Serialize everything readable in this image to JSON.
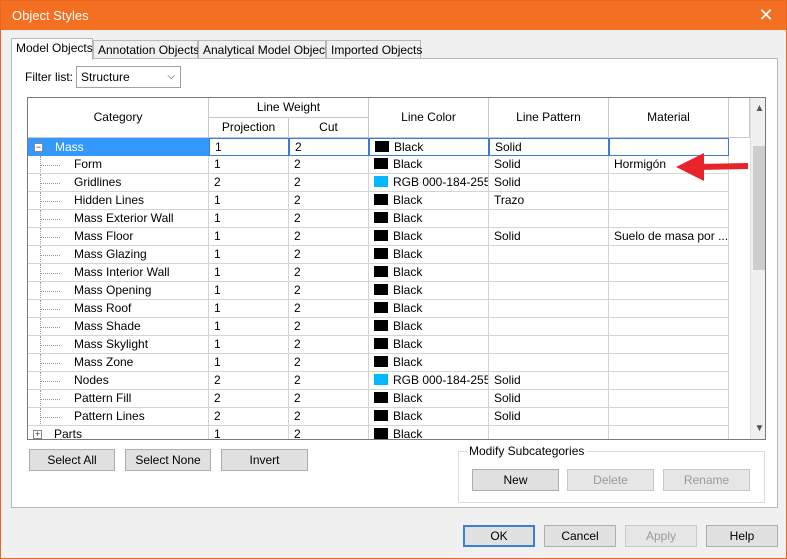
{
  "window": {
    "title": "Object Styles",
    "close_symbol": "✕"
  },
  "tabs": [
    {
      "label": "Model Objects"
    },
    {
      "label": "Annotation Objects"
    },
    {
      "label": "Analytical Model Objects"
    },
    {
      "label": "Imported Objects"
    }
  ],
  "filter": {
    "label": "Filter list:",
    "value": "Structure"
  },
  "grid": {
    "headers": {
      "category": "Category",
      "line_weight": "Line Weight",
      "projection": "Projection",
      "cut": "Cut",
      "line_color": "Line Color",
      "line_pattern": "Line Pattern",
      "material": "Material"
    },
    "rows": [
      {
        "category": "Mass",
        "projection": "1",
        "cut": "2",
        "color_hex": "#000000",
        "color": "Black",
        "pattern": "Solid",
        "material": ""
      },
      {
        "category": "Form",
        "projection": "1",
        "cut": "2",
        "color_hex": "#000000",
        "color": "Black",
        "pattern": "Solid",
        "material": "Hormigón"
      },
      {
        "category": "Gridlines",
        "projection": "2",
        "cut": "2",
        "color_hex": "#00b8ff",
        "color": "RGB 000-184-255",
        "pattern": "Solid",
        "material": ""
      },
      {
        "category": "Hidden Lines",
        "projection": "1",
        "cut": "2",
        "color_hex": "#000000",
        "color": "Black",
        "pattern": "Trazo",
        "material": ""
      },
      {
        "category": "Mass Exterior Wall",
        "projection": "1",
        "cut": "2",
        "color_hex": "#000000",
        "color": "Black",
        "pattern": "",
        "material": ""
      },
      {
        "category": "Mass Floor",
        "projection": "1",
        "cut": "2",
        "color_hex": "#000000",
        "color": "Black",
        "pattern": "Solid",
        "material": "Suelo de masa por ..."
      },
      {
        "category": "Mass Glazing",
        "projection": "1",
        "cut": "2",
        "color_hex": "#000000",
        "color": "Black",
        "pattern": "",
        "material": ""
      },
      {
        "category": "Mass Interior Wall",
        "projection": "1",
        "cut": "2",
        "color_hex": "#000000",
        "color": "Black",
        "pattern": "",
        "material": ""
      },
      {
        "category": "Mass Opening",
        "projection": "1",
        "cut": "2",
        "color_hex": "#000000",
        "color": "Black",
        "pattern": "",
        "material": ""
      },
      {
        "category": "Mass Roof",
        "projection": "1",
        "cut": "2",
        "color_hex": "#000000",
        "color": "Black",
        "pattern": "",
        "material": ""
      },
      {
        "category": "Mass Shade",
        "projection": "1",
        "cut": "2",
        "color_hex": "#000000",
        "color": "Black",
        "pattern": "",
        "material": ""
      },
      {
        "category": "Mass Skylight",
        "projection": "1",
        "cut": "2",
        "color_hex": "#000000",
        "color": "Black",
        "pattern": "",
        "material": ""
      },
      {
        "category": "Mass Zone",
        "projection": "1",
        "cut": "2",
        "color_hex": "#000000",
        "color": "Black",
        "pattern": "",
        "material": ""
      },
      {
        "category": "Nodes",
        "projection": "2",
        "cut": "2",
        "color_hex": "#00b8ff",
        "color": "RGB 000-184-255",
        "pattern": "Solid",
        "material": ""
      },
      {
        "category": "Pattern Fill",
        "projection": "2",
        "cut": "2",
        "color_hex": "#000000",
        "color": "Black",
        "pattern": "Solid",
        "material": ""
      },
      {
        "category": "Pattern Lines",
        "projection": "2",
        "cut": "2",
        "color_hex": "#000000",
        "color": "Black",
        "pattern": "Solid",
        "material": ""
      },
      {
        "category": "Parts",
        "projection": "1",
        "cut": "2",
        "color_hex": "#000000",
        "color": "Black",
        "pattern": "",
        "material": ""
      }
    ]
  },
  "buttons": {
    "select_all": "Select All",
    "select_none": "Select None",
    "invert": "Invert",
    "modify_group": "Modify Subcategories",
    "new": "New",
    "delete": "Delete",
    "rename": "Rename",
    "ok": "OK",
    "cancel": "Cancel",
    "apply": "Apply",
    "help": "Help"
  },
  "colors": {
    "titlebar": "#f36f21",
    "selection": "#3399ff",
    "annotation_arrow": "#e8242b"
  }
}
